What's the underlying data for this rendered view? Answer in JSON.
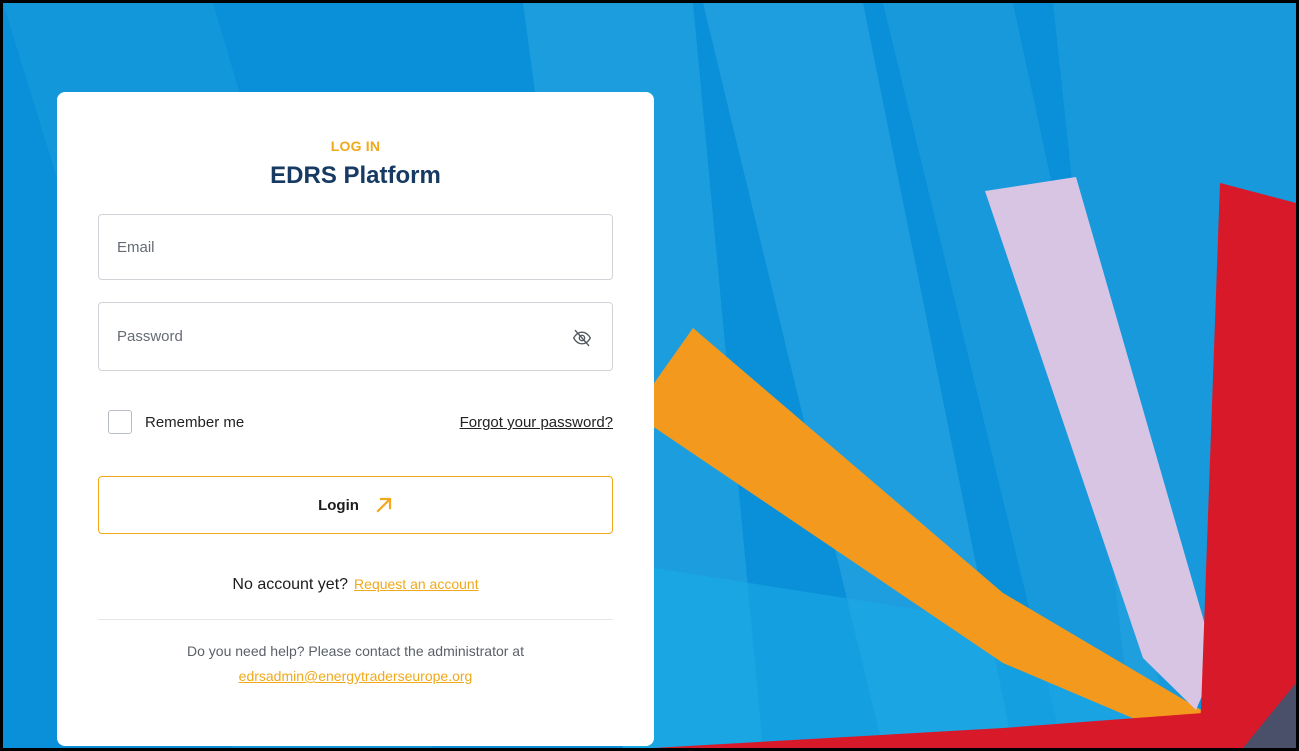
{
  "login_card": {
    "eyebrow": "LOG IN",
    "title": "EDRS Platform",
    "email": {
      "placeholder": "Email",
      "value": ""
    },
    "password": {
      "placeholder": "Password",
      "value": ""
    },
    "remember_label": "Remember me",
    "remember_checked": false,
    "forgot_label": "Forgot your password?",
    "login_label": "Login",
    "no_account_text": "No account yet?",
    "request_account_label": "Request an account",
    "help_text": "Do you need help? Please contact the administrator at",
    "help_email": "edrsadmin@energytraderseurope.org"
  },
  "icons": {
    "password_toggle": "eye-off-icon",
    "login_arrow": "arrow-up-right-icon"
  },
  "colors": {
    "accent": "#f0a91a",
    "title": "#173a63",
    "background_blue": "#0a90d8",
    "stripe_orange": "#f39a1e",
    "stripe_lavender": "#d8c5e4",
    "stripe_red": "#d8192a"
  }
}
